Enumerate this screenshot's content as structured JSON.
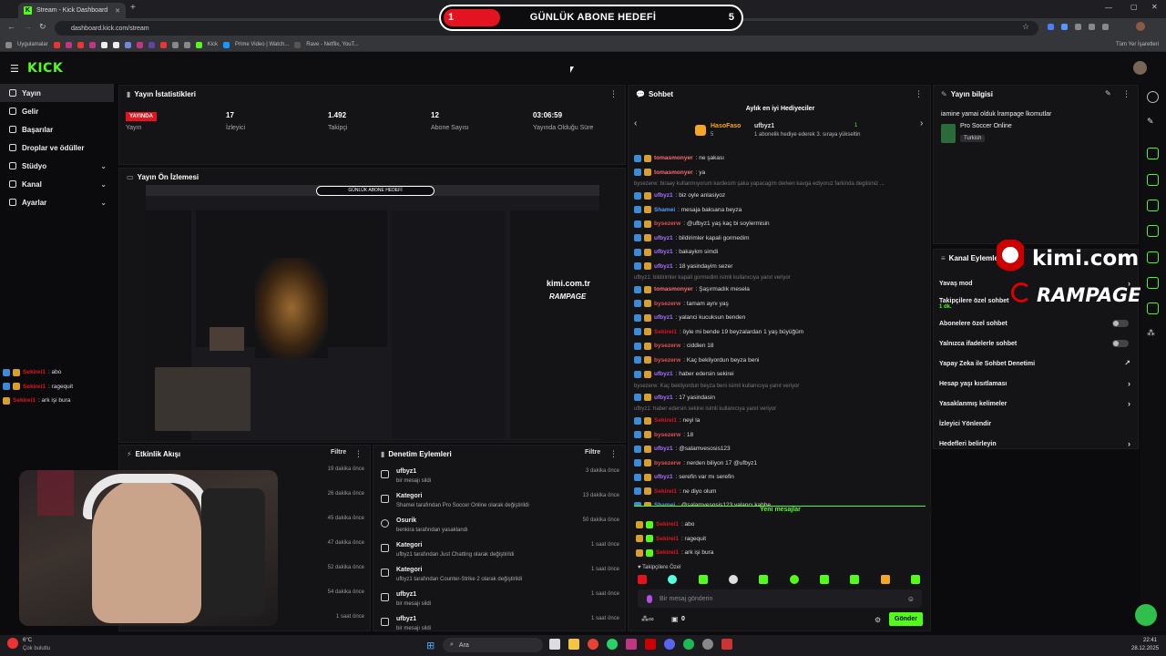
{
  "browser": {
    "tab_title": "Stream - Kick Dashboard",
    "url": "dashboard.kick.com/stream",
    "bookmarks": [
      "Uygulamalar",
      "Kick",
      "Prime Video | Watch...",
      "Rave - Netflix, YouT...",
      "Tüm Yer İşaretleri"
    ]
  },
  "goal": {
    "current": "1",
    "title": "GÜNLÜK ABONE HEDEFİ",
    "target": "5"
  },
  "kick": {
    "logo": "KICK"
  },
  "sidebar": {
    "items": [
      {
        "label": "Yayın"
      },
      {
        "label": "Gelir"
      },
      {
        "label": "Başarılar"
      },
      {
        "label": "Droplar ve ödüller"
      },
      {
        "label": "Stüdyo"
      },
      {
        "label": "Kanal"
      },
      {
        "label": "Ayarlar"
      }
    ]
  },
  "overlay_chat": [
    {
      "user": "Sekirei1",
      "msg": ": abo"
    },
    {
      "user": "Sekirei1",
      "msg": ": ragequit"
    },
    {
      "user": "Sekirei1",
      "msg": ": ark işi bura"
    }
  ],
  "stats": {
    "title": "Yayın İstatistikleri",
    "live_badge": "YAYINDA",
    "live_label": "Yayın",
    "viewers": "17",
    "viewers_label": "İzleyici",
    "followers": "1.492",
    "followers_label": "Takipçi",
    "subs": "12",
    "subs_label": "Abone Sayısı",
    "duration": "03:06:59",
    "duration_label": "Yayında Olduğu Süre"
  },
  "preview": {
    "title": "Yayın Ön İzlemesi",
    "inner_goal": "GÜNLÜK ABONE HEDEFİ",
    "inner_brand": "kimi.com.tr",
    "inner_brand2": "RAMPAGE"
  },
  "activity": {
    "title": "Etkinlik Akışı",
    "filter": "Filtre",
    "times": [
      "19 dakika önce",
      "26 dakika önce",
      "45 dakika önce",
      "47 dakika önce",
      "52 dakika önce",
      "54 dakika önce",
      "1 saat önce"
    ]
  },
  "moderation": {
    "title": "Denetim Eylemleri",
    "filter": "Filtre",
    "items": [
      {
        "name": "ufbyz1",
        "desc": "bir mesajı sildi",
        "ago": "3 dakika önce"
      },
      {
        "name": "Kategori",
        "desc": "Shamei tarafından Pro Soccer Online olarak değiştirildi",
        "ago": "13 dakika önce"
      },
      {
        "name": "Osurik",
        "desc": "benkira tarafından yasaklandı",
        "ago": "50 dakika önce"
      },
      {
        "name": "Kategori",
        "desc": "ufbyz1 tarafından Just Chatting olarak değiştirildi",
        "ago": "1 saat önce"
      },
      {
        "name": "Kategori",
        "desc": "ufbyz1 tarafından Counter-Strike 2 olarak değiştirildi",
        "ago": "1 saat önce"
      },
      {
        "name": "ufbyz1",
        "desc": "bir mesajı sildi",
        "ago": "1 saat önce"
      },
      {
        "name": "ufbyz1",
        "desc": "bir mesajı sildi",
        "ago": "1 saat önce"
      }
    ]
  },
  "chat": {
    "title": "Sohbet",
    "gifters_title": "Aylık en iyi Hediyeciler",
    "gifter1": "HasoFaso",
    "gifter1_count": "5",
    "gifter2": "ufbyz1",
    "gifter2_count": "1",
    "gifter_note": "1 abonelik hediye ederek 3. sıraya yükseltin",
    "messages": [
      {
        "user": "tomasmonyer",
        "color": "#ff6b6b",
        "msg": ": ne şakası"
      },
      {
        "user": "tomasmonyer",
        "color": "#ff6b6b",
        "msg": ": ya"
      },
      {
        "sys": "byseze​rw: biraay kullanmıyorum kardesim şaka yapacagim derken kavga ediyoruz farkinda degilsiniz ..."
      },
      {
        "user": "ufbyz1",
        "color": "#a970ff",
        "msg": ": biz oyle anlasiyoz"
      },
      {
        "user": "Shamei",
        "color": "#5b9bff",
        "msg": ": mesaja baksana beyza"
      },
      {
        "user": "byseze​rw",
        "color": "#e05252",
        "msg": ": @ufbyz1 yaş kaç bi soylermisin"
      },
      {
        "user": "ufbyz1",
        "color": "#a970ff",
        "msg": ": bildirimler kapali gormedim"
      },
      {
        "user": "ufbyz1",
        "color": "#a970ff",
        "msg": ": bakaykm simdi"
      },
      {
        "user": "ufbyz1",
        "color": "#a970ff",
        "msg": ": 18 yasindayim sezer"
      },
      {
        "sys": "ufbyz1: bildirimler kapali gormedim isimli kullanıcıya yanıt veriyor"
      },
      {
        "user": "tomasmonyer",
        "color": "#ff6b6b",
        "msg": ": Şaşırmadık mesela"
      },
      {
        "user": "byseze​rw",
        "color": "#e05252",
        "msg": ": tamam aynı yaş"
      },
      {
        "user": "ufbyz1",
        "color": "#a970ff",
        "msg": ": yalanci kucuksun benden"
      },
      {
        "user": "Sekirei1",
        "color": "#e3141f",
        "msg": ": öyle mi bende 19 beyzalardan 1 yaş büyüğüm"
      },
      {
        "user": "byseze​rw",
        "color": "#e05252",
        "msg": ": ciddien 18"
      },
      {
        "user": "byseze​rw",
        "color": "#e05252",
        "msg": ": Kaç bekliyordun beyza beni"
      },
      {
        "user": "ufbyz1",
        "color": "#a970ff",
        "msg": ": haber edersin sekirei"
      },
      {
        "sys": "byseze​rw: Kaç bekliyordun beyza beni isimli kullanıcıya yanıt veriyor"
      },
      {
        "user": "ufbyz1",
        "color": "#a970ff",
        "msg": ": 17 yasindasin"
      },
      {
        "sys": "ufbyz1: haber edersin sekirei isimli kullanıcıya yanıt veriyor"
      },
      {
        "user": "Sekirei1",
        "color": "#e3141f",
        "msg": ": neyi la"
      },
      {
        "user": "byseze​rw",
        "color": "#e05252",
        "msg": ": 18"
      },
      {
        "user": "ufbyz1",
        "color": "#a970ff",
        "msg": ": @salamvesosis123"
      },
      {
        "user": "byseze​rw",
        "color": "#e05252",
        "msg": ": nerden biliyon 17 @ufbyz1"
      },
      {
        "user": "ufbyz1",
        "color": "#a970ff",
        "msg": ": serefin var mı serefin"
      },
      {
        "user": "Sekirei1",
        "color": "#e3141f",
        "msg": ": ne diyo olum"
      },
      {
        "user": "Shamei",
        "color": "#5b9bff",
        "msg": ": @salamvesosis123 yalancı kahbe"
      }
    ],
    "new_messages": "Yeni mesajlar",
    "new": [
      {
        "user": "Sekirei1",
        "msg": ": abo"
      },
      {
        "user": "Sekirei1",
        "msg": ": ragequit"
      },
      {
        "user": "Sekirei1",
        "msg": ": ark işi bura"
      }
    ],
    "followers_only": "Takipçilere Özel",
    "placeholder": "Bir mesaj gönderin",
    "send": "Gönder",
    "count": "0"
  },
  "stream_info": {
    "title": "Yayın bilgisi",
    "stream_title": "iamine yamai olduk lrampage lkomutlar",
    "category": "Pro Soccer Online",
    "language": "Turkish"
  },
  "channel_actions": {
    "title": "Kanal Eylemleri",
    "rows": [
      {
        "label": "Yavaş mod"
      },
      {
        "label": "Takipçilere özel sohbet",
        "sub": "1 dk."
      },
      {
        "label": "Abonelere özel sohbet"
      },
      {
        "label": "Yalnızca ifadelerle sohbet"
      },
      {
        "label": "Yapay Zeka ile Sohbet Denetimi"
      },
      {
        "label": "Hesap yaşı kısıtlaması"
      },
      {
        "label": "Yasaklanmış kelimeler"
      },
      {
        "label": "İzleyici Yönlendir"
      },
      {
        "label": "Hedefleri belirleyin"
      }
    ]
  },
  "sponsor": {
    "brand": "kimi.com.tr",
    "brand2": "RAMPAGE"
  },
  "taskbar": {
    "weather_temp": "6°C",
    "weather": "Çok bulutlu",
    "search": "Ara",
    "time": "22:41",
    "date": "28.12.2025"
  },
  "colors": {
    "kick_green": "#53fc18",
    "live_red": "#e3141f"
  }
}
